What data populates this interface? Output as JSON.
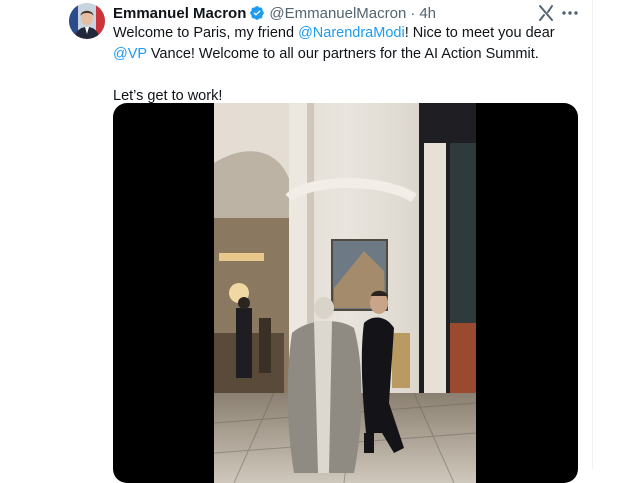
{
  "author": {
    "name": "Emmanuel Macron",
    "handle": "@EmmanuelMacron",
    "separator": "·",
    "time": "4h"
  },
  "tweet": {
    "p1_a": "Welcome to Paris, my friend ",
    "mention_1": "@NarendraModi",
    "p1_b": "! Nice to meet you dear ",
    "mention_2": "@VP",
    "p1_c": " Vance! Welcome to all our partners for the AI Action Summit.",
    "p2": "Let’s get to work!"
  },
  "icons": {
    "verified": "verified-badge-icon",
    "grok": "grok-icon",
    "more": "more-icon"
  },
  "colors": {
    "link": "#1d9bf0",
    "verified": "#1d9bf0",
    "text": "#0f1419",
    "muted": "#536471"
  }
}
